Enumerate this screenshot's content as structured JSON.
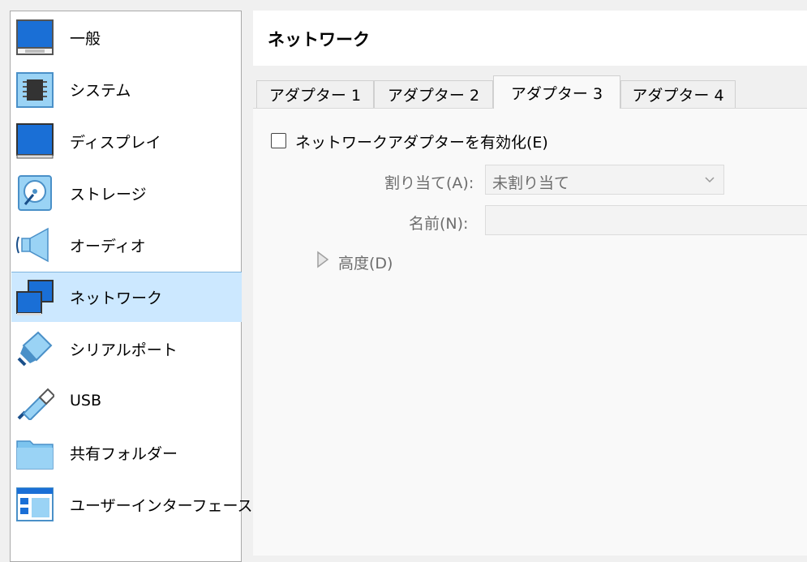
{
  "sidebar": {
    "items": [
      {
        "label": "一般",
        "icon": "general-icon"
      },
      {
        "label": "システム",
        "icon": "system-chip-icon"
      },
      {
        "label": "ディスプレイ",
        "icon": "display-monitor-icon"
      },
      {
        "label": "ストレージ",
        "icon": "storage-disk-icon"
      },
      {
        "label": "オーディオ",
        "icon": "audio-speaker-icon"
      },
      {
        "label": "ネットワーク",
        "icon": "network-icon",
        "selected": true
      },
      {
        "label": "シリアルポート",
        "icon": "serial-port-icon"
      },
      {
        "label": "USB",
        "icon": "usb-icon"
      },
      {
        "label": "共有フォルダー",
        "icon": "shared-folder-icon"
      },
      {
        "label": "ユーザーインターフェース",
        "icon": "user-interface-icon"
      }
    ]
  },
  "header": {
    "title": "ネットワーク"
  },
  "tabs": [
    {
      "label": "アダプター 1"
    },
    {
      "label": "アダプター 2"
    },
    {
      "label": "アダプター 3",
      "active": true
    },
    {
      "label": "アダプター 4"
    }
  ],
  "panel": {
    "enable_label": "ネットワークアダプターを有効化(E)",
    "enable_checked": false,
    "attached_label": "割り当て(A):",
    "attached_value": "未割り当て",
    "name_label": "名前(N):",
    "name_value": "",
    "advanced_label": "高度(D)"
  },
  "colors": {
    "accent_blue": "#1e78d7",
    "selection": "#cce8ff",
    "disabled_text": "#6d6d6d"
  }
}
